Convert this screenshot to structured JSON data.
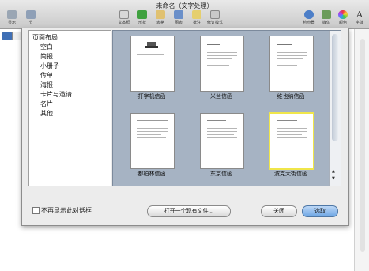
{
  "window": {
    "title": "未命名（文字处理）"
  },
  "toolbar": {
    "left_items": [
      {
        "label": "显示",
        "icon": "view-icon"
      },
      {
        "label": "节",
        "icon": "sections-icon"
      }
    ],
    "center_items": [
      {
        "label": "文本框",
        "icon": "text-box-icon"
      },
      {
        "label": "形状",
        "icon": "shape-icon"
      },
      {
        "label": "表格",
        "icon": "table-icon"
      },
      {
        "label": "图表",
        "icon": "chart-icon"
      },
      {
        "label": "批注",
        "icon": "comment-icon"
      },
      {
        "label": "修订模式",
        "icon": "track-changes-icon"
      }
    ],
    "right_items": [
      {
        "label": "检查器",
        "icon": "inspector-icon"
      },
      {
        "label": "媒体",
        "icon": "media-icon"
      },
      {
        "label": "颜色",
        "icon": "colors-icon"
      },
      {
        "label": "字体",
        "icon": "fonts-icon"
      }
    ]
  },
  "categories": [
    {
      "label": "页面布局"
    },
    {
      "label": "空白"
    },
    {
      "label": "简报"
    },
    {
      "label": "小册子"
    },
    {
      "label": "传单"
    },
    {
      "label": "海报"
    },
    {
      "label": "卡片与邀请"
    },
    {
      "label": "名片"
    },
    {
      "label": "其他"
    }
  ],
  "templates": [
    {
      "label": "打字机信函",
      "selected": false
    },
    {
      "label": "米兰信函",
      "selected": false
    },
    {
      "label": "维也纳信函",
      "selected": false
    },
    {
      "label": "都柏林信函",
      "selected": false
    },
    {
      "label": "东京信函",
      "selected": false
    },
    {
      "label": "波克大街信函",
      "selected": true
    }
  ],
  "footer": {
    "checkbox_label": "不再显示此对话框",
    "checkbox_checked": false,
    "open_existing_label": "打开一个现有文件...",
    "close_label": "关闭",
    "choose_label": "选取"
  },
  "colors": {
    "template_pane_bg": "#a6b3c3",
    "selection_border": "#f0e64a",
    "primary_button": "#6ea6e4"
  }
}
